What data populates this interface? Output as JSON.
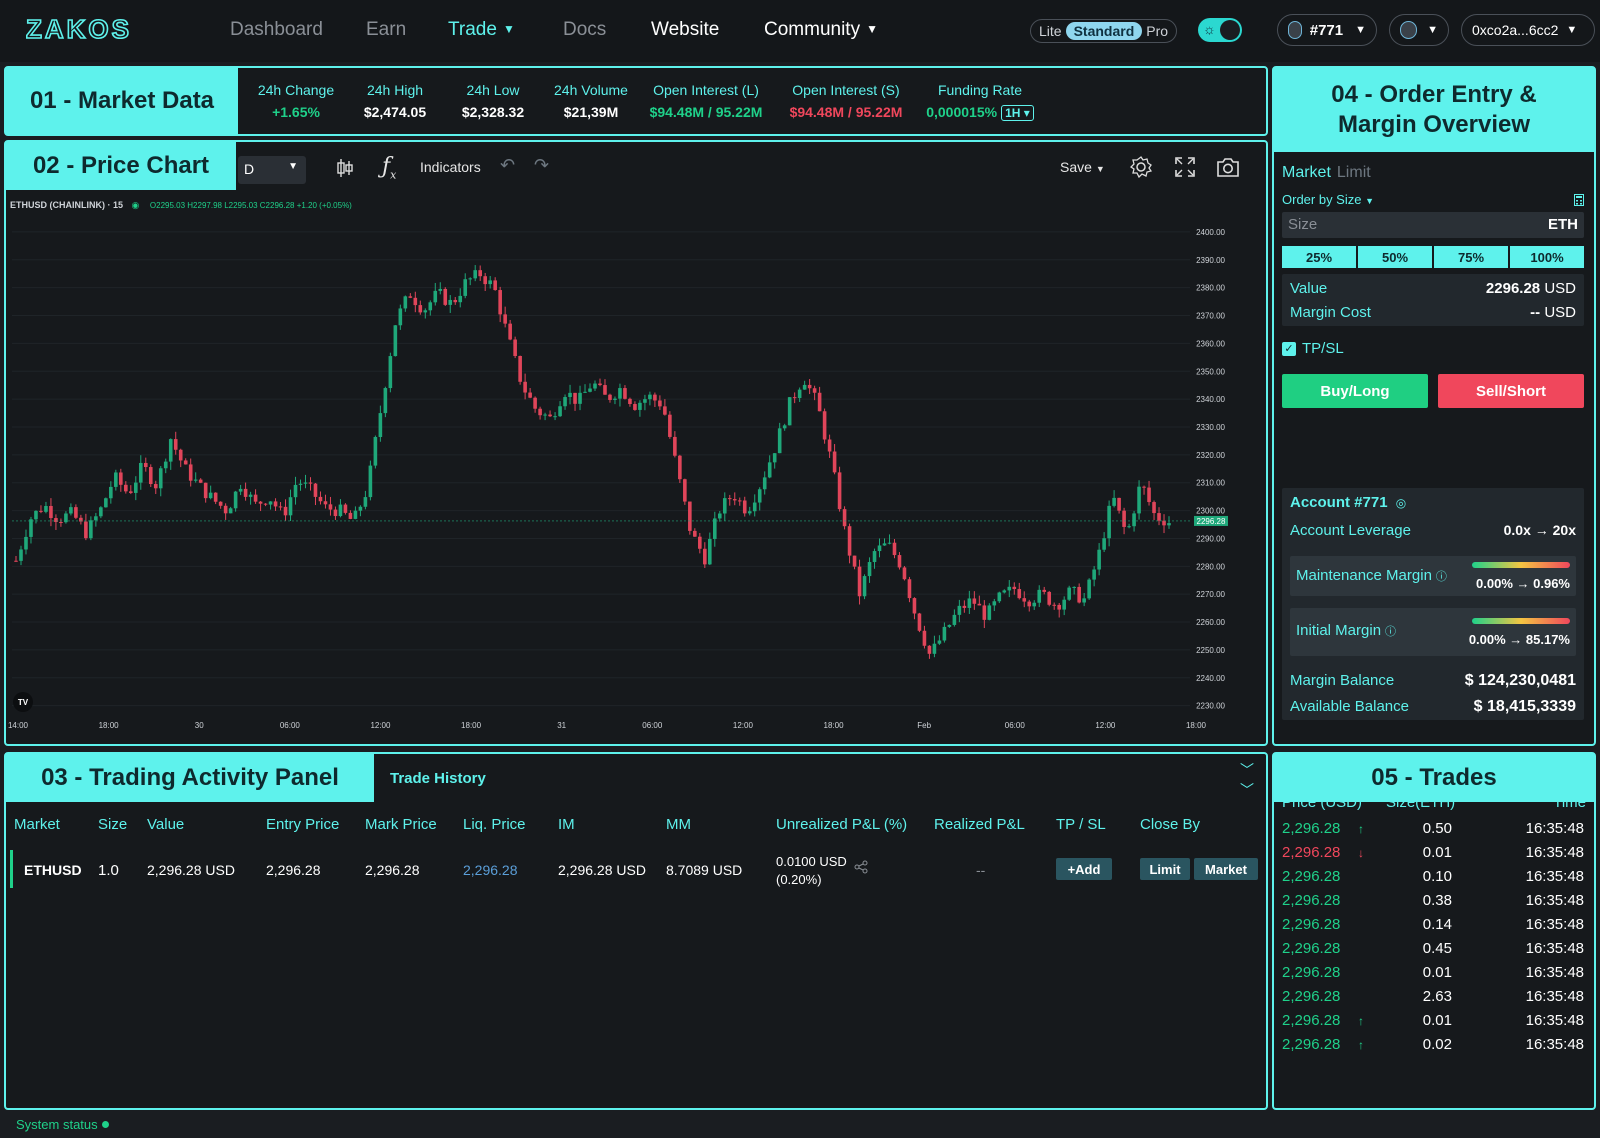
{
  "nav": {
    "logo": "ZAKOS",
    "items": [
      {
        "label": "Dashboard",
        "state": "muted"
      },
      {
        "label": "Earn",
        "state": "muted"
      },
      {
        "label": "Trade",
        "state": "active",
        "dropdown": true
      },
      {
        "label": "Docs",
        "state": "muted"
      },
      {
        "label": "Website",
        "state": "white"
      },
      {
        "label": "Community",
        "state": "white",
        "dropdown": true
      }
    ],
    "modes": [
      "Lite",
      "Standard",
      "Pro"
    ],
    "selected_mode": "Standard",
    "account_pill": "#771",
    "wallet": "0xco2a...6cc2"
  },
  "market": {
    "title": "01 - Market Data",
    "stats": [
      {
        "label": "24h Change",
        "value": "+1.65%",
        "color": "green"
      },
      {
        "label": "24h High",
        "value": "$2,474.05",
        "color": "white"
      },
      {
        "label": "24h Low",
        "value": "$2,328.32",
        "color": "white"
      },
      {
        "label": "24h Volume",
        "value": "$21,39M",
        "color": "white"
      },
      {
        "label": "Open Interest (L)",
        "value": "$94.48M / 95.22M",
        "color": "green"
      },
      {
        "label": "Open Interest (S)",
        "value": "$94.48M / 95.22M",
        "color": "red"
      },
      {
        "label": "Funding Rate",
        "value": "0,000015%",
        "color": "green"
      }
    ],
    "funding_interval": "1H"
  },
  "chart": {
    "title": "02 - Price Chart",
    "interval": "D",
    "indicators_label": "Indicators",
    "save_label": "Save",
    "legend_symbol": "ETHUSD (CHAINLINK) · 15",
    "legend_ohlc": "O2295.03 H2297.98 L2295.03 C2296.28 +1.20 (+0.05%)",
    "current_price_label": "2296.28",
    "logo_mark": "TV"
  },
  "chart_data": {
    "type": "candlestick",
    "symbol": "ETHUSD",
    "y_ticks": [
      "2400.00",
      "2390.00",
      "2380.00",
      "2370.00",
      "2360.00",
      "2350.00",
      "2340.00",
      "2330.00",
      "2320.00",
      "2310.00",
      "2300.00",
      "2290.00",
      "2280.00",
      "2270.00",
      "2260.00",
      "2250.00",
      "2240.00",
      "2230.00"
    ],
    "x_ticks": [
      "14:00",
      "18:00",
      "30",
      "06:00",
      "12:00",
      "18:00",
      "31",
      "06:00",
      "12:00",
      "18:00",
      "Feb",
      "06:00",
      "12:00",
      "18:00"
    ],
    "ylim": [
      2227,
      2405
    ],
    "last_price": 2296.28,
    "path_points": [
      2282,
      2297,
      2302,
      2297,
      2299,
      2292,
      2300,
      2312,
      2306,
      2316,
      2309,
      2326,
      2315,
      2309,
      2304,
      2300,
      2310,
      2302,
      2305,
      2298,
      2311,
      2307,
      2301,
      2300,
      2296,
      2308,
      2338,
      2368,
      2378,
      2372,
      2378,
      2374,
      2382,
      2385,
      2380,
      2362,
      2345,
      2336,
      2333,
      2343,
      2339,
      2346,
      2340,
      2344,
      2338,
      2341,
      2338,
      2315,
      2292,
      2283,
      2300,
      2306,
      2300,
      2310,
      2323,
      2338,
      2348,
      2338,
      2317,
      2291,
      2270,
      2285,
      2288,
      2280,
      2262,
      2248,
      2256,
      2264,
      2268,
      2262,
      2269,
      2272,
      2268,
      2270,
      2266,
      2271,
      2268,
      2284,
      2305,
      2291,
      2310,
      2298,
      2296
    ]
  },
  "order": {
    "title": "04 - Order Entry & Margin Overview",
    "tabs": [
      "Market",
      "Limit"
    ],
    "order_by": "Order by Size",
    "size_placeholder": "Size",
    "size_unit": "ETH",
    "pcts": [
      "25%",
      "50%",
      "75%",
      "100%"
    ],
    "value_label": "Value",
    "value_amount": "2296.28",
    "value_unit": "USD",
    "margin_cost_label": "Margin Cost",
    "margin_cost_amount": "--",
    "margin_cost_unit": "USD",
    "tpsl_label": "TP/SL",
    "buy_label": "Buy/Long",
    "sell_label": "Sell/Short"
  },
  "account": {
    "title": "Account #771",
    "leverage_label": "Account Leverage",
    "leverage_value": "0.0x → 20x",
    "maintenance_label": "Maintenance Margin",
    "maintenance_value": "0.00% → 0.96%",
    "initial_label": "Initial Margin",
    "initial_value": "0.00% → 85.17%",
    "margin_balance_label": "Margin Balance",
    "margin_balance_value": "$ 124,230,0481",
    "available_label": "Available Balance",
    "available_value": "$ 18,415,3339"
  },
  "activity": {
    "title": "03 - Trading Activity Panel",
    "tab2": "Trade History",
    "headers": [
      "Market",
      "Size",
      "Value",
      "Entry Price",
      "Mark Price",
      "Liq. Price",
      "IM",
      "MM",
      "Unrealized P&L (%)",
      "Realized P&L",
      "TP / SL",
      "Close By"
    ],
    "row": {
      "market": "ETHUSD",
      "size": "1.0",
      "value": "2,296.28 USD",
      "entry": "2,296.28",
      "mark": "2,296.28",
      "liq": "2,296.28",
      "im": "2,296.28 USD",
      "mm": "8.7089 USD",
      "upnl": "0.0100 USD",
      "upnl_pct": "(0.20%)",
      "rpnl": "--",
      "add_label": "+Add",
      "limit_label": "Limit",
      "market_label": "Market"
    }
  },
  "trades": {
    "title": "05 - Trades",
    "headers": [
      "Price (USD)",
      "Size(ETH)",
      "Time"
    ],
    "rows": [
      {
        "price": "2,296.28",
        "dir": "up",
        "size": "0.50",
        "time": "16:35:48"
      },
      {
        "price": "2,296.28",
        "dir": "down",
        "size": "0.01",
        "time": "16:35:48"
      },
      {
        "price": "2,296.28",
        "dir": "",
        "size": "0.10",
        "time": "16:35:48"
      },
      {
        "price": "2,296.28",
        "dir": "",
        "size": "0.38",
        "time": "16:35:48"
      },
      {
        "price": "2,296.28",
        "dir": "",
        "size": "0.14",
        "time": "16:35:48"
      },
      {
        "price": "2,296.28",
        "dir": "",
        "size": "0.45",
        "time": "16:35:48"
      },
      {
        "price": "2,296.28",
        "dir": "",
        "size": "0.01",
        "time": "16:35:48"
      },
      {
        "price": "2,296.28",
        "dir": "",
        "size": "2.63",
        "time": "16:35:48"
      },
      {
        "price": "2,296.28",
        "dir": "up",
        "size": "0.01",
        "time": "16:35:48"
      },
      {
        "price": "2,296.28",
        "dir": "up",
        "size": "0.02",
        "time": "16:35:48"
      }
    ]
  },
  "status": "System status",
  "colors": {
    "accent": "#5ef2ec",
    "green": "#1fd18a",
    "red": "#f0475c",
    "bg": "#1a1d21"
  }
}
